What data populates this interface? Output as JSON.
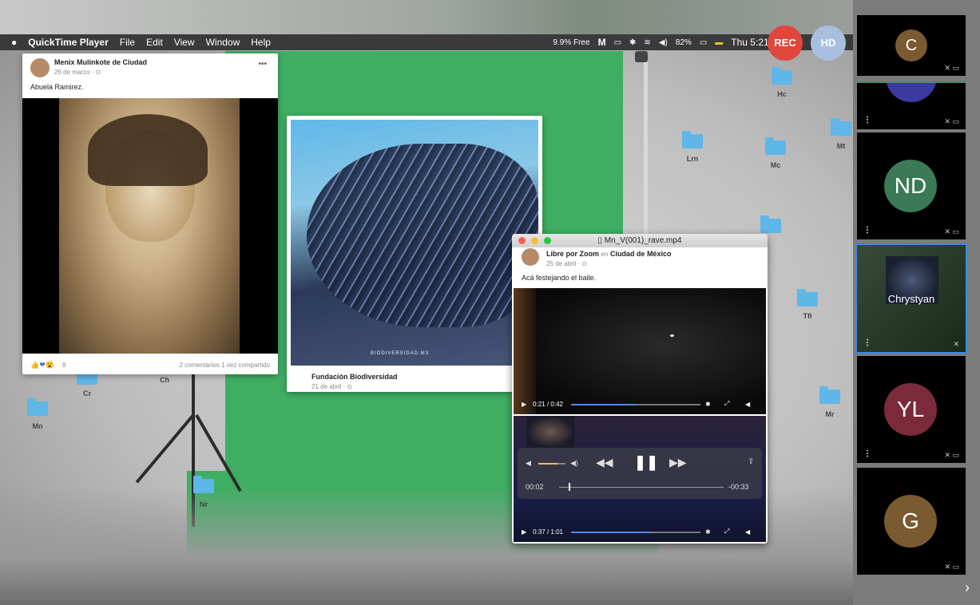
{
  "menubar": {
    "apple": "",
    "app_name": "QuickTime Player",
    "items": [
      "File",
      "Edit",
      "View",
      "Window",
      "Help"
    ],
    "status": {
      "mem": "9.9% Free",
      "battery": "82%",
      "clock": "Thu 5:21 PM"
    }
  },
  "recording": {
    "rec_label": "REC",
    "hd_label": "HD"
  },
  "post1": {
    "author": "Menix Mulinkote de Ciudad",
    "date": "26 de marzo · ⊙",
    "caption": "Abuela Ramirez.",
    "reactions_count": "8",
    "stats": "2 comentarios  1 vez compartido",
    "menu": "•••"
  },
  "post2": {
    "watermark": "BIODIVERSIDAD.MX",
    "source": "Fundación Biodiversidad",
    "date": "21 de abril · ⊙"
  },
  "qt_window": {
    "title": "Mn_V(001)_rave.mp4",
    "author": "Libre por Zoom",
    "in_word": "en",
    "location": "Ciudad de México",
    "date": "25 de abril · ⊙",
    "caption": "Acá festejando el baile.",
    "player1": {
      "time": "0:21 / 0:42",
      "progress": 0.5
    },
    "overlay": {
      "elapsed": "00:02",
      "remaining": "-00:33",
      "volume": 0.7,
      "progress": 0.06
    },
    "player2": {
      "time": "0:37 / 1:01",
      "progress": 0.61
    }
  },
  "desktop_folders": [
    "Hc",
    "Lrn",
    "Mc",
    "Mt",
    "Tfi",
    "Mr",
    "Cr",
    "Ch",
    "Mn",
    "Nr"
  ],
  "participants": [
    {
      "initials": "C",
      "color": "#7a5a30"
    },
    {
      "initials": "",
      "color": "#3a3aa0"
    },
    {
      "initials": "ND",
      "color": "#3a7a56"
    },
    {
      "initials": "",
      "name": "Chrystyan",
      "active": true
    },
    {
      "initials": "YL",
      "color": "#7a2a3a"
    },
    {
      "initials": "G",
      "color": "#7a5a30"
    }
  ],
  "rail_arrow": "›"
}
